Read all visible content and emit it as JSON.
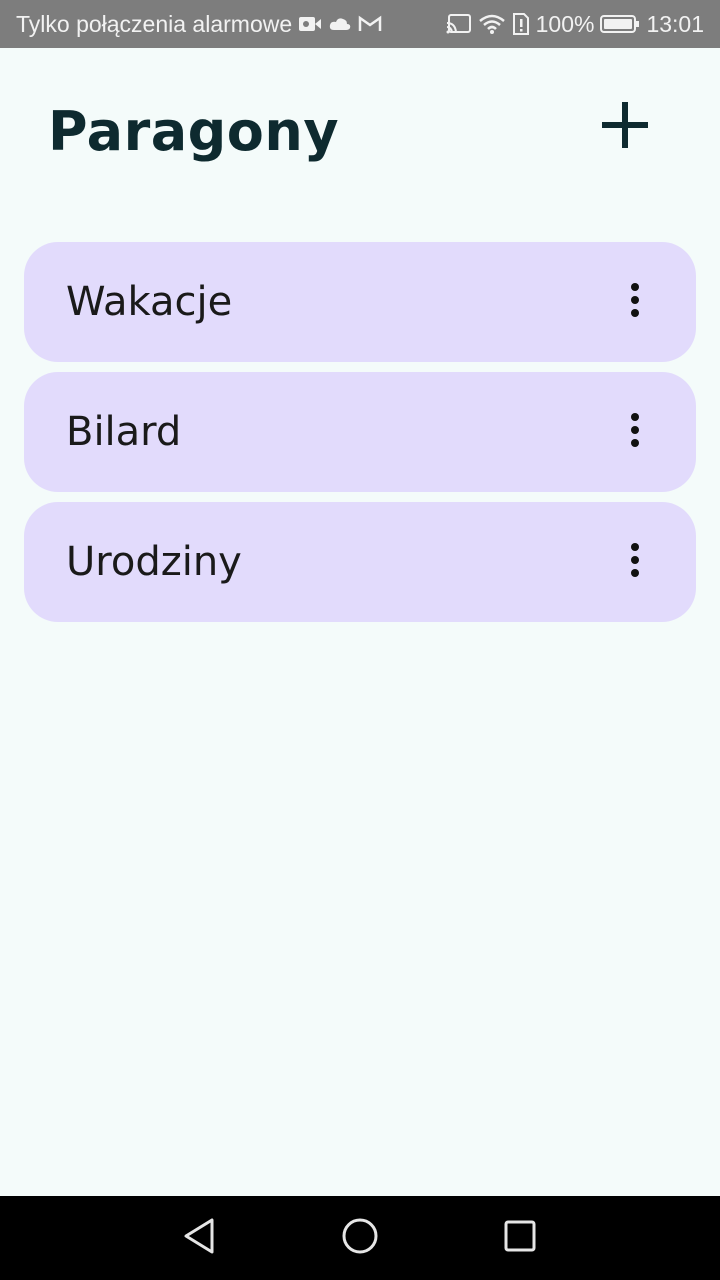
{
  "status_bar": {
    "carrier_text": "Tylko połączenia alarmowe",
    "battery_percent": "100%",
    "time": "13:01",
    "icons_left": [
      "video-call-icon",
      "cloud-icon",
      "gmail-icon"
    ],
    "icons_right": [
      "cast-icon",
      "wifi-icon",
      "sim-alert-icon",
      "battery-icon"
    ]
  },
  "header": {
    "title": "Paragony",
    "add_icon": "plus-icon"
  },
  "list": {
    "items": [
      {
        "label": "Wakacje",
        "menu_icon": "more-vertical-icon"
      },
      {
        "label": "Bilard",
        "menu_icon": "more-vertical-icon"
      },
      {
        "label": "Urodziny",
        "menu_icon": "more-vertical-icon"
      }
    ]
  },
  "nav_bar": {
    "icons": [
      "back-icon",
      "home-icon",
      "recents-icon"
    ]
  },
  "colors": {
    "background": "#f4fbfa",
    "card": "#e2dbfc",
    "title": "#0e2a2f",
    "status_bar": "#7d7d7d"
  }
}
